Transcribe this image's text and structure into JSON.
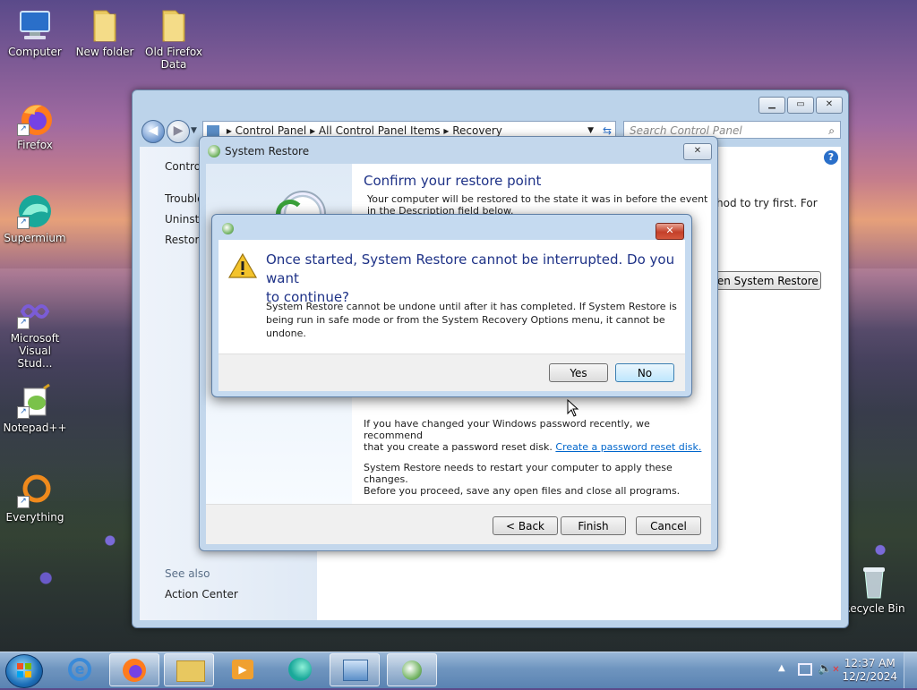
{
  "desktop": {
    "icons": [
      {
        "label": "Computer"
      },
      {
        "label": "New folder"
      },
      {
        "label": "Old Firefox Data"
      },
      {
        "label": "Firefox"
      },
      {
        "label": "Supermium"
      },
      {
        "label": "Microsoft Visual Stud..."
      },
      {
        "label": "Notepad++"
      },
      {
        "label": "Everything"
      },
      {
        "label": "Recycle Bin"
      }
    ]
  },
  "control_panel": {
    "breadcrumb": [
      "Control Panel",
      "All Control Panel Items",
      "Recovery"
    ],
    "search_placeholder": "Search Control Panel",
    "left_links": [
      "Control",
      "Trouble",
      "Uninsta",
      "Restore"
    ],
    "see_also_heading": "See also",
    "see_also_link": "Action Center",
    "body_fragment": "hod to try first. For",
    "open_restore_button": "pen System Restore"
  },
  "system_restore": {
    "title": "System Restore",
    "heading": "Confirm your restore point",
    "intro_line1": "Your computer will be restored to the state it was in before the event",
    "intro_line2": "in the Description field below.",
    "password_line1": "If you have changed your Windows password recently, we recommend",
    "password_line2": "that you create a password reset disk.",
    "password_link": "Create a password reset disk.",
    "restart_line1": "System Restore needs to restart your computer to apply these changes.",
    "restart_line2": "Before you proceed, save any open files and close all programs.",
    "back_button": "< Back",
    "finish_button": "Finish",
    "cancel_button": "Cancel"
  },
  "confirm_dialog": {
    "main_instruction_line1": "Once started, System Restore cannot be interrupted. Do you want",
    "main_instruction_line2": "to continue?",
    "content_line1": "System Restore cannot be undone until after it has completed. If System Restore is",
    "content_line2": "being run in safe mode or from the System Recovery Options menu, it cannot be",
    "content_line3": "undone.",
    "yes_button": "Yes",
    "no_button": "No"
  },
  "taskbar": {
    "time": "12:37 AM",
    "date": "12/2/2024"
  },
  "colors": {
    "title_text": "#1e3287",
    "link": "#0066cc",
    "accent": "#3c7fb1"
  }
}
